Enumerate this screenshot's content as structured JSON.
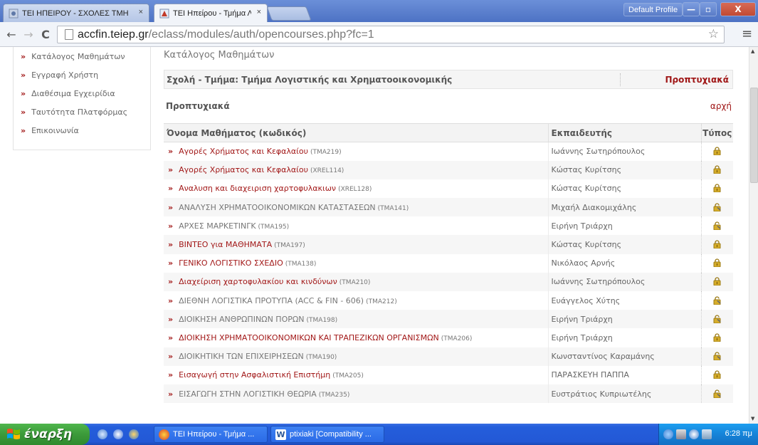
{
  "browser": {
    "tabs": [
      {
        "title": "ΤΕΙ ΗΠΕΙΡΟΥ - ΣΧΟΛΕΣ ΤΜΗ",
        "active": false
      },
      {
        "title": "ΤΕΙ Ηπείρου - Τμήμα Λογιστι",
        "active": true
      }
    ],
    "profile_label": "Default Profile",
    "tab_close": "×",
    "url_host": "accfin.teiep.gr",
    "url_path": "/eclass/modules/auth/opencourses.php?fc=1",
    "nav": {
      "back": "←",
      "forward": "→",
      "reload": "C",
      "star": "☆",
      "menu": "≡"
    },
    "window_buttons": {
      "minimize": "—",
      "maximize": "▫",
      "close": "X"
    }
  },
  "sidebar": {
    "items": [
      {
        "label": "Κατάλογος Μαθημάτων"
      },
      {
        "label": "Εγγραφή Χρήστη"
      },
      {
        "label": "Διαθέσιμα Εγχειρίδια"
      },
      {
        "label": "Ταυτότητα Πλατφόρμας"
      },
      {
        "label": "Επικοινωνία"
      }
    ]
  },
  "content": {
    "page_title": "Κατάλογος Μαθημάτων",
    "faculty_label": "Σχολή - Τμήμα: Τμήμα Λογιστικής και Χρηματοοικονομικής",
    "faculty_level": "Προπτυχιακά",
    "section_label": "Προπτυχιακά",
    "top_link": "αρχή",
    "table": {
      "headers": {
        "name": "Όνομα Μαθήματος (κωδικός)",
        "instructor": "Εκπαιδευτής",
        "type": "Τύπος"
      },
      "rows": [
        {
          "name": "Αγορές Χρήματος και Κεφαλαίου",
          "code": "(TMA219)",
          "instructor": "Ιωάννης Σωτηρόπουλος",
          "lock": "closed"
        },
        {
          "name": "Αγορές Χρήματος και Κεφαλαίου",
          "code": "(XREL114)",
          "instructor": "Κώστας Κυρίτσης",
          "lock": "closed"
        },
        {
          "name": "Αναλυση και διαχειριση χαρτοφυλακιων",
          "code": "(XREL128)",
          "instructor": "Κώστας Κυρίτσης",
          "lock": "closed"
        },
        {
          "name": "ΑΝΑΛΥΣΗ ΧΡΗΜΑΤΟΟΙΚΟΝΟΜΙΚΩΝ ΚΑΤΑΣΤΑΣΕΩΝ",
          "code": "(TMA141)",
          "instructor": "Μιχαήλ Διακομιχάλης",
          "lock": "open"
        },
        {
          "name": "ΑΡΧΕΣ ΜΑΡΚΕΤΙΝΓΚ",
          "code": "(TMA195)",
          "instructor": "Ειρήνη Τριάρχη",
          "lock": "open"
        },
        {
          "name": "ΒΙΝΤΕΟ για ΜΑΘΗΜΑΤΑ",
          "code": "(TMA197)",
          "instructor": "Κώστας Κυρίτσης",
          "lock": "closed"
        },
        {
          "name": "ΓΕΝΙΚΟ ΛΟΓΙΣΤΙΚΟ ΣΧΕΔΙΟ",
          "code": "(TMA138)",
          "instructor": "Νικόλαος Αρνής",
          "lock": "closed"
        },
        {
          "name": "Διαχείριση χαρτοφυλακίου και κινδύνων",
          "code": "(TMA210)",
          "instructor": "Ιωάννης Σωτηρόπουλος",
          "lock": "closed"
        },
        {
          "name": "ΔΙΕΘΝΗ ΛΟΓΙΣΤΙΚΑ ΠΡΟΤΥΠΑ (ACC & FIN - 606)",
          "code": "(TMA212)",
          "instructor": "Ευάγγελος Χύτης",
          "lock": "open"
        },
        {
          "name": "ΔΙΟΙΚΗΣΗ ΑΝΘΡΩΠΙΝΩΝ ΠΟΡΩΝ",
          "code": "(TMA198)",
          "instructor": "Ειρήνη Τριάρχη",
          "lock": "open"
        },
        {
          "name": "ΔΙΟΙΚΗΣΗ ΧΡΗΜΑΤΟΟΙΚΟΝΟΜΙΚΩΝ ΚΑΙ ΤΡΑΠΕΖΙΚΩΝ ΟΡΓΑΝΙΣΜΩΝ",
          "code": "(TMA206)",
          "instructor": "Ειρήνη Τριάρχη",
          "lock": "closed"
        },
        {
          "name": "ΔΙΟΙΚΗΤΙΚΗ ΤΩΝ ΕΠΙΧΕΙΡΗΣΕΩΝ",
          "code": "(TMA190)",
          "instructor": "Κωνσταντίνος Καραμάνης",
          "lock": "open"
        },
        {
          "name": "Εισαγωγή στην Ασφαλιστική Επιστήμη",
          "code": "(TMA205)",
          "instructor": "ΠΑΡΑΣΚΕΥΗ ΠΑΠΠΑ",
          "lock": "closed"
        },
        {
          "name": "ΕΙΣΑΓΩΓΗ ΣΤΗΝ ΛΟΓΙΣΤΙΚΗ ΘΕΩΡΙΑ",
          "code": "(TMA235)",
          "instructor": "Ευστράτιος Κυπριωτέλης",
          "lock": "open"
        }
      ]
    }
  },
  "taskbar": {
    "start_label": "έναρξη",
    "tasks": [
      {
        "title": "ΤΕΙ Ηπείρου - Τμήμα ..."
      },
      {
        "title": "ptixiaki [Compatibility ..."
      }
    ],
    "clock": "6:28 πμ"
  },
  "colors": {
    "accent_red": "#a21818",
    "locked_gold": "#c9a227",
    "taskbar_blue": "#245edb",
    "start_green": "#3c9a3a"
  }
}
